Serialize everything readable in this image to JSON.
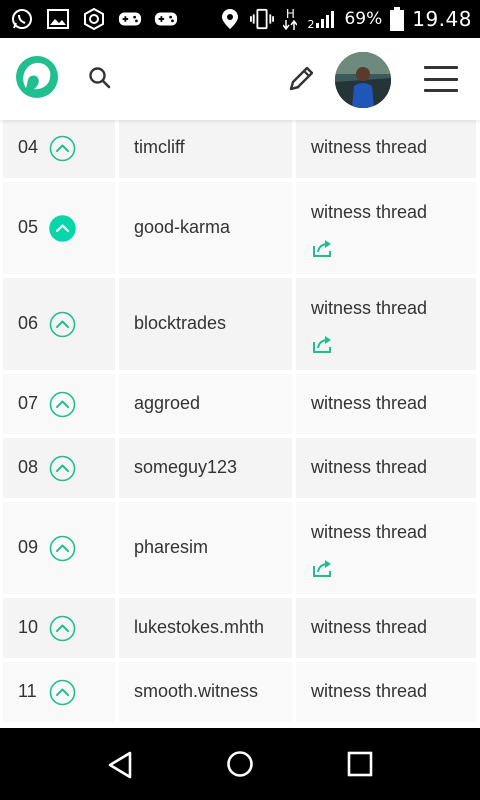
{
  "status_bar": {
    "battery_percent": "69%",
    "time": "19.48",
    "network_label": "H",
    "signal_sub": "2",
    "icons": [
      "whatsapp-icon",
      "image-icon",
      "hexagon-icon",
      "game-controller-icon",
      "game-controller-icon",
      "location-pin-icon",
      "vibrate-icon",
      "data-arrows-icon",
      "signal-icon",
      "battery-icon"
    ]
  },
  "header": {
    "logo": "steemit-logo",
    "search_icon": "search-icon",
    "edit_icon": "pencil-icon",
    "avatar": "user-avatar",
    "menu_icon": "hamburger-menu-icon"
  },
  "colors": {
    "accent": "#1fbf8f",
    "upvote_active_bg": "#06d6a9",
    "text": "#333333",
    "cell_bg": "#f4f4f4"
  },
  "witness_rows": [
    {
      "rank": "04",
      "name": "timcliff",
      "link_text": "witness thread",
      "voted": false,
      "has_external_link": false
    },
    {
      "rank": "05",
      "name": "good-karma",
      "link_text": "witness thread",
      "voted": true,
      "has_external_link": true
    },
    {
      "rank": "06",
      "name": "blocktrades",
      "link_text": "witness thread",
      "voted": false,
      "has_external_link": true
    },
    {
      "rank": "07",
      "name": "aggroed",
      "link_text": "witness thread",
      "voted": false,
      "has_external_link": false
    },
    {
      "rank": "08",
      "name": "someguy123",
      "link_text": "witness thread",
      "voted": false,
      "has_external_link": false
    },
    {
      "rank": "09",
      "name": "pharesim",
      "link_text": "witness thread",
      "voted": false,
      "has_external_link": true
    },
    {
      "rank": "10",
      "name": "lukestokes.mhth",
      "link_text": "witness thread",
      "voted": false,
      "has_external_link": false
    },
    {
      "rank": "11",
      "name": "smooth.witness",
      "link_text": "witness thread",
      "voted": false,
      "has_external_link": false
    }
  ],
  "nav_bar": {
    "icons": [
      "back-icon",
      "home-icon",
      "recent-apps-icon"
    ]
  }
}
